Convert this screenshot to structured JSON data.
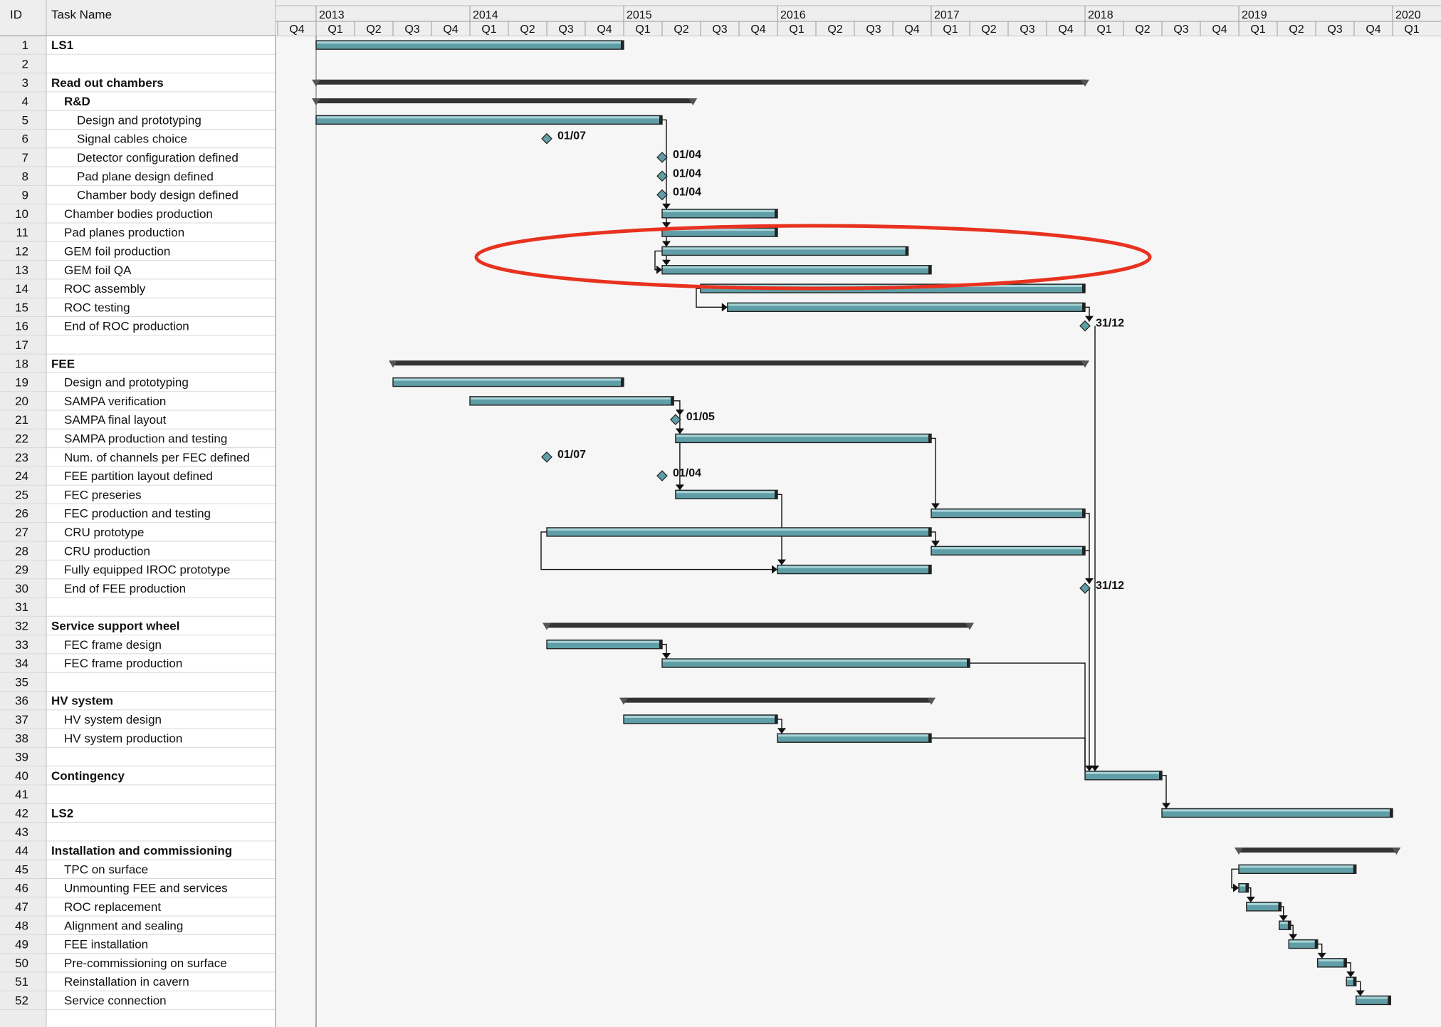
{
  "table": {
    "id_header": "ID",
    "name_header": "Task Name"
  },
  "timeline": {
    "years": [
      "2013",
      "2014",
      "2015",
      "2016",
      "2017",
      "2018",
      "2019",
      "2020"
    ],
    "quarters": [
      "Q4",
      "Q1",
      "Q2",
      "Q3",
      "Q4",
      "Q1",
      "Q2",
      "Q3",
      "Q4",
      "Q1",
      "Q2",
      "Q3",
      "Q4",
      "Q1",
      "Q2",
      "Q3",
      "Q4",
      "Q1",
      "Q2",
      "Q3",
      "Q4",
      "Q1",
      "Q2",
      "Q3",
      "Q4",
      "Q1",
      "Q2",
      "Q3",
      "Q4",
      "Q1"
    ]
  },
  "colors": {
    "bar_fill": "#5f9ea6",
    "summary_bar": "#333333",
    "highlight_ellipse": "#e8321f",
    "grid": "#d8d8d8",
    "header_bg": "#eeeeee",
    "chart_bg": "#f6f6f6"
  },
  "tasks": [
    {
      "id": 1,
      "name": "LS1",
      "level": 0,
      "bold": true,
      "type": "bar",
      "start": 1,
      "end": 9
    },
    {
      "id": 2,
      "name": "",
      "level": 0,
      "bold": false,
      "type": "none"
    },
    {
      "id": 3,
      "name": "Read out chambers",
      "level": 0,
      "bold": true,
      "type": "summary",
      "start": 1,
      "end": 21
    },
    {
      "id": 4,
      "name": "R&D",
      "level": 1,
      "bold": true,
      "type": "summary",
      "start": 1,
      "end": 10.8
    },
    {
      "id": 5,
      "name": "Design and prototyping",
      "level": 2,
      "bold": false,
      "type": "bar",
      "start": 1,
      "end": 10
    },
    {
      "id": 6,
      "name": "Signal cables choice",
      "level": 2,
      "bold": false,
      "type": "milestone",
      "at": 7,
      "label": "01/07"
    },
    {
      "id": 7,
      "name": "Detector configuration defined",
      "level": 2,
      "bold": false,
      "type": "milestone",
      "at": 10,
      "label": "01/04"
    },
    {
      "id": 8,
      "name": "Pad plane design defined",
      "level": 2,
      "bold": false,
      "type": "milestone",
      "at": 10,
      "label": "01/04"
    },
    {
      "id": 9,
      "name": "Chamber body design defined",
      "level": 2,
      "bold": false,
      "type": "milestone",
      "at": 10,
      "label": "01/04"
    },
    {
      "id": 10,
      "name": "Chamber bodies production",
      "level": 1,
      "bold": false,
      "type": "bar",
      "start": 10,
      "end": 13
    },
    {
      "id": 11,
      "name": "Pad planes production",
      "level": 1,
      "bold": false,
      "type": "bar",
      "start": 10,
      "end": 13
    },
    {
      "id": 12,
      "name": "GEM foil production",
      "level": 1,
      "bold": false,
      "type": "bar",
      "start": 10,
      "end": 16.4
    },
    {
      "id": 13,
      "name": "GEM foil QA",
      "level": 1,
      "bold": false,
      "type": "bar",
      "start": 10,
      "end": 17
    },
    {
      "id": 14,
      "name": "ROC assembly",
      "level": 1,
      "bold": false,
      "type": "bar",
      "start": 11,
      "end": 21
    },
    {
      "id": 15,
      "name": "ROC testing",
      "level": 1,
      "bold": false,
      "type": "bar",
      "start": 11.7,
      "end": 21
    },
    {
      "id": 16,
      "name": "End of ROC production",
      "level": 1,
      "bold": false,
      "type": "milestone",
      "at": 21,
      "label": "31/12"
    },
    {
      "id": 17,
      "name": "",
      "level": 0,
      "bold": false,
      "type": "none"
    },
    {
      "id": 18,
      "name": "FEE",
      "level": 0,
      "bold": true,
      "type": "summary",
      "start": 3,
      "end": 21
    },
    {
      "id": 19,
      "name": "Design and prototyping",
      "level": 1,
      "bold": false,
      "type": "bar",
      "start": 3,
      "end": 9
    },
    {
      "id": 20,
      "name": "SAMPA verification",
      "level": 1,
      "bold": false,
      "type": "bar",
      "start": 5,
      "end": 10.3
    },
    {
      "id": 21,
      "name": "SAMPA final layout",
      "level": 1,
      "bold": false,
      "type": "milestone",
      "at": 10.35,
      "label": "01/05"
    },
    {
      "id": 22,
      "name": "SAMPA production and testing",
      "level": 1,
      "bold": false,
      "type": "bar",
      "start": 10.35,
      "end": 17
    },
    {
      "id": 23,
      "name": "Num. of channels per FEC defined",
      "level": 1,
      "bold": false,
      "type": "milestone",
      "at": 7,
      "label": "01/07"
    },
    {
      "id": 24,
      "name": "FEE partition layout defined",
      "level": 1,
      "bold": false,
      "type": "milestone",
      "at": 10,
      "label": "01/04"
    },
    {
      "id": 25,
      "name": "FEC preseries",
      "level": 1,
      "bold": false,
      "type": "bar",
      "start": 10.35,
      "end": 13
    },
    {
      "id": 26,
      "name": "FEC production and testing",
      "level": 1,
      "bold": false,
      "type": "bar",
      "start": 17,
      "end": 21
    },
    {
      "id": 27,
      "name": "CRU prototype",
      "level": 1,
      "bold": false,
      "type": "bar",
      "start": 7,
      "end": 17
    },
    {
      "id": 28,
      "name": "CRU production",
      "level": 1,
      "bold": false,
      "type": "bar",
      "start": 17,
      "end": 21
    },
    {
      "id": 29,
      "name": "Fully equipped IROC prototype",
      "level": 1,
      "bold": false,
      "type": "bar",
      "start": 13,
      "end": 17
    },
    {
      "id": 30,
      "name": "End of FEE production",
      "level": 1,
      "bold": false,
      "type": "milestone",
      "at": 21,
      "label": "31/12"
    },
    {
      "id": 31,
      "name": "",
      "level": 0,
      "bold": false,
      "type": "none"
    },
    {
      "id": 32,
      "name": "Service support wheel",
      "level": 0,
      "bold": true,
      "type": "summary",
      "start": 7,
      "end": 18
    },
    {
      "id": 33,
      "name": "FEC frame design",
      "level": 1,
      "bold": false,
      "type": "bar",
      "start": 7,
      "end": 10
    },
    {
      "id": 34,
      "name": "FEC frame production",
      "level": 1,
      "bold": false,
      "type": "bar",
      "start": 10,
      "end": 18
    },
    {
      "id": 35,
      "name": "",
      "level": 0,
      "bold": false,
      "type": "none"
    },
    {
      "id": 36,
      "name": "HV system",
      "level": 0,
      "bold": true,
      "type": "summary",
      "start": 9,
      "end": 17
    },
    {
      "id": 37,
      "name": "HV system design",
      "level": 1,
      "bold": false,
      "type": "bar",
      "start": 9,
      "end": 13
    },
    {
      "id": 38,
      "name": "HV system production",
      "level": 1,
      "bold": false,
      "type": "bar",
      "start": 13,
      "end": 17
    },
    {
      "id": 39,
      "name": "",
      "level": 0,
      "bold": false,
      "type": "none"
    },
    {
      "id": 40,
      "name": "Contingency",
      "level": 0,
      "bold": true,
      "type": "bar",
      "start": 21,
      "end": 23
    },
    {
      "id": 41,
      "name": "",
      "level": 0,
      "bold": false,
      "type": "none"
    },
    {
      "id": 42,
      "name": "LS2",
      "level": 0,
      "bold": true,
      "type": "bar",
      "start": 23,
      "end": 29
    },
    {
      "id": 43,
      "name": "",
      "level": 0,
      "bold": false,
      "type": "none"
    },
    {
      "id": 44,
      "name": "Installation and commissioning",
      "level": 0,
      "bold": true,
      "type": "summary",
      "start": 25,
      "end": 29.1
    },
    {
      "id": 45,
      "name": "TPC on surface",
      "level": 1,
      "bold": false,
      "type": "bar",
      "start": 25,
      "end": 28.05
    },
    {
      "id": 46,
      "name": "Unmounting FEE and services",
      "level": 1,
      "bold": false,
      "type": "bar",
      "start": 25,
      "end": 25.25
    },
    {
      "id": 47,
      "name": "ROC replacement",
      "level": 1,
      "bold": false,
      "type": "bar",
      "start": 25.2,
      "end": 26.1
    },
    {
      "id": 48,
      "name": "Alignment and sealing",
      "level": 1,
      "bold": false,
      "type": "bar",
      "start": 26.05,
      "end": 26.35
    },
    {
      "id": 49,
      "name": "FEE installation",
      "level": 1,
      "bold": false,
      "type": "bar",
      "start": 26.3,
      "end": 27.05
    },
    {
      "id": 50,
      "name": "Pre-commissioning on surface",
      "level": 1,
      "bold": false,
      "type": "bar",
      "start": 27.05,
      "end": 27.8
    },
    {
      "id": 51,
      "name": "Reinstallation in cavern",
      "level": 1,
      "bold": false,
      "type": "bar",
      "start": 27.8,
      "end": 28.05
    },
    {
      "id": 52,
      "name": "Service connection",
      "level": 1,
      "bold": false,
      "type": "bar",
      "start": 28.05,
      "end": 28.95
    }
  ]
}
